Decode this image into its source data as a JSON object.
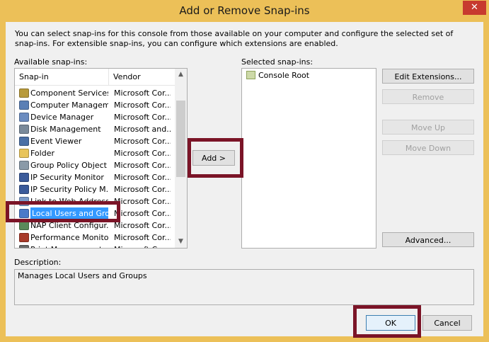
{
  "window": {
    "title": "Add or Remove Snap-ins",
    "close_glyph": "✕"
  },
  "intro_text": "You can select snap-ins for this console from those available on your computer and configure the selected set of snap-ins. For extensible snap-ins, you can configure which extensions are enabled.",
  "available": {
    "label": "Available snap-ins:",
    "columns": [
      "Snap-in",
      "Vendor"
    ],
    "rows": [
      {
        "name": "Component Services",
        "vendor": "Microsoft Cor...",
        "icon": "component-services-icon",
        "color": "#b89a3a"
      },
      {
        "name": "Computer Managem...",
        "vendor": "Microsoft Cor...",
        "icon": "computer-management-icon",
        "color": "#5a7fb5"
      },
      {
        "name": "Device Manager",
        "vendor": "Microsoft Cor...",
        "icon": "device-manager-icon",
        "color": "#6b8cc0"
      },
      {
        "name": "Disk Management",
        "vendor": "Microsoft and...",
        "icon": "disk-management-icon",
        "color": "#7a8a9a"
      },
      {
        "name": "Event Viewer",
        "vendor": "Microsoft Cor...",
        "icon": "event-viewer-icon",
        "color": "#4a6fa5"
      },
      {
        "name": "Folder",
        "vendor": "Microsoft Cor...",
        "icon": "folder-icon",
        "color": "#e8c45a"
      },
      {
        "name": "Group Policy Object ...",
        "vendor": "Microsoft Cor...",
        "icon": "group-policy-icon",
        "color": "#8a9aa8"
      },
      {
        "name": "IP Security Monitor",
        "vendor": "Microsoft Cor...",
        "icon": "ip-security-monitor-icon",
        "color": "#3a5a9a"
      },
      {
        "name": "IP Security Policy M...",
        "vendor": "Microsoft Cor...",
        "icon": "ip-security-policy-icon",
        "color": "#3a5a9a"
      },
      {
        "name": "Link to Web Address",
        "vendor": "Microsoft Cor...",
        "icon": "link-icon",
        "color": "#7a9ac8"
      },
      {
        "name": "Local Users and Gro...",
        "vendor": "Microsoft Cor...",
        "icon": "local-users-icon",
        "color": "#4a7ac8"
      },
      {
        "name": "NAP Client Configur...",
        "vendor": "Microsoft Cor...",
        "icon": "nap-client-icon",
        "color": "#5a8a5a"
      },
      {
        "name": "Performance Monitor",
        "vendor": "Microsoft Cor...",
        "icon": "performance-monitor-icon",
        "color": "#a83a2a"
      },
      {
        "name": "Print Management",
        "vendor": "Microsoft Cor...",
        "icon": "print-management-icon",
        "color": "#6a6a6a"
      }
    ],
    "selected_index": 10
  },
  "add_button": "Add >",
  "selected": {
    "label": "Selected snap-ins:",
    "root": "Console Root"
  },
  "side_buttons": {
    "edit_extensions": "Edit Extensions...",
    "remove": "Remove",
    "move_up": "Move Up",
    "move_down": "Move Down",
    "advanced": "Advanced..."
  },
  "description": {
    "label": "Description:",
    "text": "Manages Local Users and Groups"
  },
  "footer": {
    "ok": "OK",
    "cancel": "Cancel"
  },
  "colors": {
    "titlebar": "#ecc058",
    "highlight": "#7b1427",
    "selection": "#3399ff",
    "close": "#c73a2f"
  }
}
